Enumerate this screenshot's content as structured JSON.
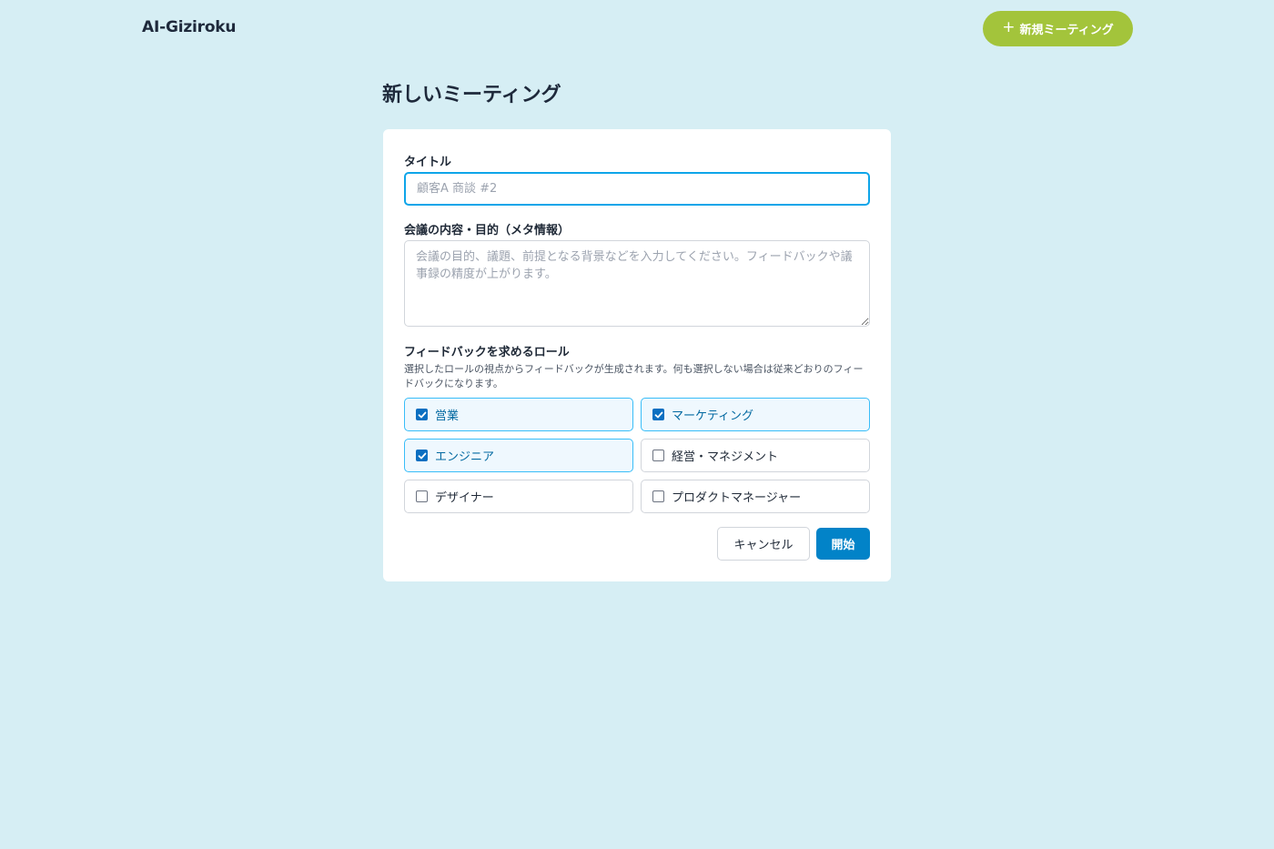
{
  "header": {
    "brand": "AI-Giziroku",
    "new_meeting_button": "新規ミーティング",
    "plus_icon": "plus-icon"
  },
  "page": {
    "title": "新しいミーティング"
  },
  "form": {
    "title_label": "タイトル",
    "title_placeholder": "顧客A 商談 #2",
    "title_value": "",
    "meta_label": "会議の内容・目的（メタ情報）",
    "meta_placeholder": "会議の目的、議題、前提となる背景などを入力してください。フィードバックや議事録の精度が上がります。",
    "meta_value": "",
    "roles_label": "フィードバックを求めるロール",
    "roles_hint": "選択したロールの視点からフィードバックが生成されます。何も選択しない場合は従来どおりのフィードバックになります。",
    "roles": [
      {
        "label": "営業",
        "checked": true
      },
      {
        "label": "マーケティング",
        "checked": true
      },
      {
        "label": "エンジニア",
        "checked": true
      },
      {
        "label": "経営・マネジメント",
        "checked": false
      },
      {
        "label": "デザイナー",
        "checked": false
      },
      {
        "label": "プロダクトマネージャー",
        "checked": false
      }
    ],
    "cancel_button": "キャンセル",
    "start_button": "開始"
  },
  "colors": {
    "background": "#d6eef4",
    "accent_green": "#a3c43b",
    "primary_blue": "#0283c8",
    "focus_border": "#0ea5e9"
  }
}
